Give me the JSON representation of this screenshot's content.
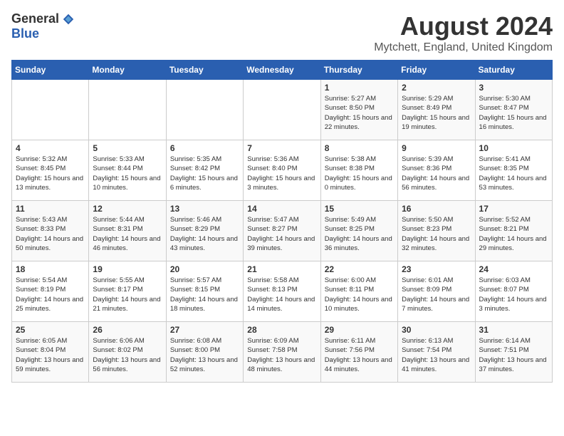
{
  "header": {
    "logo_general": "General",
    "logo_blue": "Blue",
    "title": "August 2024",
    "location": "Mytchett, England, United Kingdom"
  },
  "days_of_week": [
    "Sunday",
    "Monday",
    "Tuesday",
    "Wednesday",
    "Thursday",
    "Friday",
    "Saturday"
  ],
  "weeks": [
    [
      {
        "day": "",
        "sunrise": "",
        "sunset": "",
        "daylight": ""
      },
      {
        "day": "",
        "sunrise": "",
        "sunset": "",
        "daylight": ""
      },
      {
        "day": "",
        "sunrise": "",
        "sunset": "",
        "daylight": ""
      },
      {
        "day": "",
        "sunrise": "",
        "sunset": "",
        "daylight": ""
      },
      {
        "day": "1",
        "sunrise": "5:27 AM",
        "sunset": "8:50 PM",
        "daylight": "15 hours and 22 minutes."
      },
      {
        "day": "2",
        "sunrise": "5:29 AM",
        "sunset": "8:49 PM",
        "daylight": "15 hours and 19 minutes."
      },
      {
        "day": "3",
        "sunrise": "5:30 AM",
        "sunset": "8:47 PM",
        "daylight": "15 hours and 16 minutes."
      }
    ],
    [
      {
        "day": "4",
        "sunrise": "5:32 AM",
        "sunset": "8:45 PM",
        "daylight": "15 hours and 13 minutes."
      },
      {
        "day": "5",
        "sunrise": "5:33 AM",
        "sunset": "8:44 PM",
        "daylight": "15 hours and 10 minutes."
      },
      {
        "day": "6",
        "sunrise": "5:35 AM",
        "sunset": "8:42 PM",
        "daylight": "15 hours and 6 minutes."
      },
      {
        "day": "7",
        "sunrise": "5:36 AM",
        "sunset": "8:40 PM",
        "daylight": "15 hours and 3 minutes."
      },
      {
        "day": "8",
        "sunrise": "5:38 AM",
        "sunset": "8:38 PM",
        "daylight": "15 hours and 0 minutes."
      },
      {
        "day": "9",
        "sunrise": "5:39 AM",
        "sunset": "8:36 PM",
        "daylight": "14 hours and 56 minutes."
      },
      {
        "day": "10",
        "sunrise": "5:41 AM",
        "sunset": "8:35 PM",
        "daylight": "14 hours and 53 minutes."
      }
    ],
    [
      {
        "day": "11",
        "sunrise": "5:43 AM",
        "sunset": "8:33 PM",
        "daylight": "14 hours and 50 minutes."
      },
      {
        "day": "12",
        "sunrise": "5:44 AM",
        "sunset": "8:31 PM",
        "daylight": "14 hours and 46 minutes."
      },
      {
        "day": "13",
        "sunrise": "5:46 AM",
        "sunset": "8:29 PM",
        "daylight": "14 hours and 43 minutes."
      },
      {
        "day": "14",
        "sunrise": "5:47 AM",
        "sunset": "8:27 PM",
        "daylight": "14 hours and 39 minutes."
      },
      {
        "day": "15",
        "sunrise": "5:49 AM",
        "sunset": "8:25 PM",
        "daylight": "14 hours and 36 minutes."
      },
      {
        "day": "16",
        "sunrise": "5:50 AM",
        "sunset": "8:23 PM",
        "daylight": "14 hours and 32 minutes."
      },
      {
        "day": "17",
        "sunrise": "5:52 AM",
        "sunset": "8:21 PM",
        "daylight": "14 hours and 29 minutes."
      }
    ],
    [
      {
        "day": "18",
        "sunrise": "5:54 AM",
        "sunset": "8:19 PM",
        "daylight": "14 hours and 25 minutes."
      },
      {
        "day": "19",
        "sunrise": "5:55 AM",
        "sunset": "8:17 PM",
        "daylight": "14 hours and 21 minutes."
      },
      {
        "day": "20",
        "sunrise": "5:57 AM",
        "sunset": "8:15 PM",
        "daylight": "14 hours and 18 minutes."
      },
      {
        "day": "21",
        "sunrise": "5:58 AM",
        "sunset": "8:13 PM",
        "daylight": "14 hours and 14 minutes."
      },
      {
        "day": "22",
        "sunrise": "6:00 AM",
        "sunset": "8:11 PM",
        "daylight": "14 hours and 10 minutes."
      },
      {
        "day": "23",
        "sunrise": "6:01 AM",
        "sunset": "8:09 PM",
        "daylight": "14 hours and 7 minutes."
      },
      {
        "day": "24",
        "sunrise": "6:03 AM",
        "sunset": "8:07 PM",
        "daylight": "14 hours and 3 minutes."
      }
    ],
    [
      {
        "day": "25",
        "sunrise": "6:05 AM",
        "sunset": "8:04 PM",
        "daylight": "13 hours and 59 minutes."
      },
      {
        "day": "26",
        "sunrise": "6:06 AM",
        "sunset": "8:02 PM",
        "daylight": "13 hours and 56 minutes."
      },
      {
        "day": "27",
        "sunrise": "6:08 AM",
        "sunset": "8:00 PM",
        "daylight": "13 hours and 52 minutes."
      },
      {
        "day": "28",
        "sunrise": "6:09 AM",
        "sunset": "7:58 PM",
        "daylight": "13 hours and 48 minutes."
      },
      {
        "day": "29",
        "sunrise": "6:11 AM",
        "sunset": "7:56 PM",
        "daylight": "13 hours and 44 minutes."
      },
      {
        "day": "30",
        "sunrise": "6:13 AM",
        "sunset": "7:54 PM",
        "daylight": "13 hours and 41 minutes."
      },
      {
        "day": "31",
        "sunrise": "6:14 AM",
        "sunset": "7:51 PM",
        "daylight": "13 hours and 37 minutes."
      }
    ]
  ]
}
